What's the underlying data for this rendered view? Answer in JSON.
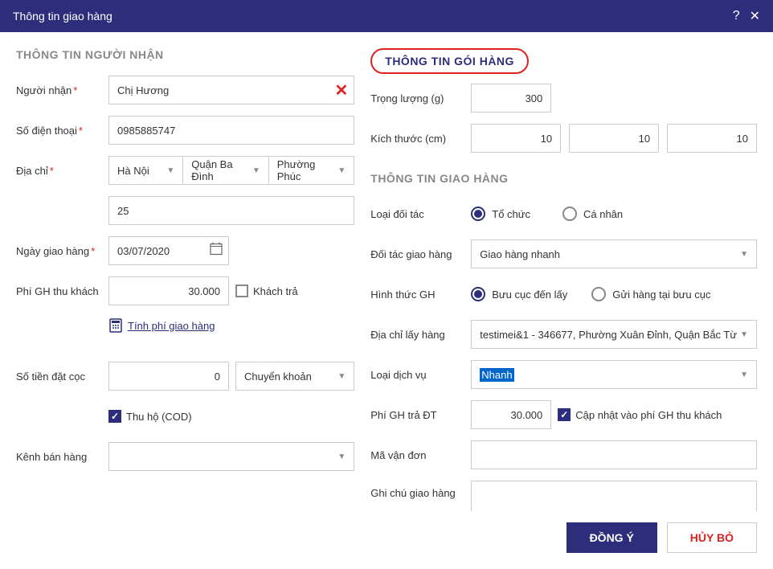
{
  "title": "Thông tin giao hàng",
  "left": {
    "section": "THÔNG TIN NGƯỜI NHẬN",
    "recipient_label": "Người nhận",
    "recipient_value": "Chị Hương",
    "phone_label": "Số điện thoại",
    "phone_value": "0985885747",
    "address_label": "Địa chỉ",
    "city": "Hà Nội",
    "district": "Quận Ba Đình",
    "ward": "Phường Phúc",
    "street": "25",
    "delivery_date_label": "Ngày giao hàng",
    "delivery_date": "03/07/2020",
    "cust_fee_label": "Phí GH thu khách",
    "cust_fee": "30.000",
    "cust_pays_label": "Khách trả",
    "calc_fee_link": "Tính phí giao hàng",
    "deposit_label": "Số tiền đặt cọc",
    "deposit": "0",
    "deposit_method": "Chuyển khoản",
    "cod_label": "Thu hộ (COD)",
    "channel_label": "Kênh bán hàng",
    "channel": ""
  },
  "right": {
    "section_pkg": "THÔNG TIN GÓI HÀNG",
    "weight_label": "Trọng lượng (g)",
    "weight": "300",
    "dim_label": "Kích thước (cm)",
    "dim_l": "10",
    "dim_w": "10",
    "dim_h": "10",
    "section_ship": "THÔNG TIN GIAO HÀNG",
    "partner_type_label": "Loại đối tác",
    "partner_org": "Tổ chức",
    "partner_ind": "Cá nhân",
    "partner_label": "Đối tác giao hàng",
    "partner": "Giao hàng nhanh",
    "ship_method_label": "Hình thức GH",
    "method_pickup": "Bưu cục đến lấy",
    "method_dropoff": "Gửi hàng tại bưu cục",
    "pickup_addr_label": "Địa chỉ lấy hàng",
    "pickup_addr": "testimei&1 - 346677, Phường Xuân Đỉnh, Quận Bắc Từ",
    "service_label": "Loại dịch vụ",
    "service": "Nhanh",
    "partner_fee_label": "Phí GH trả ĐT",
    "partner_fee": "30.000",
    "sync_fee_label": "Cập nhật vào phí GH thu khách",
    "tracking_label": "Mã vận đơn",
    "tracking": "",
    "notes_label": "Ghi chú giao hàng",
    "notes": ""
  },
  "footer": {
    "ok": "ĐỒNG Ý",
    "cancel": "HỦY BỎ"
  }
}
